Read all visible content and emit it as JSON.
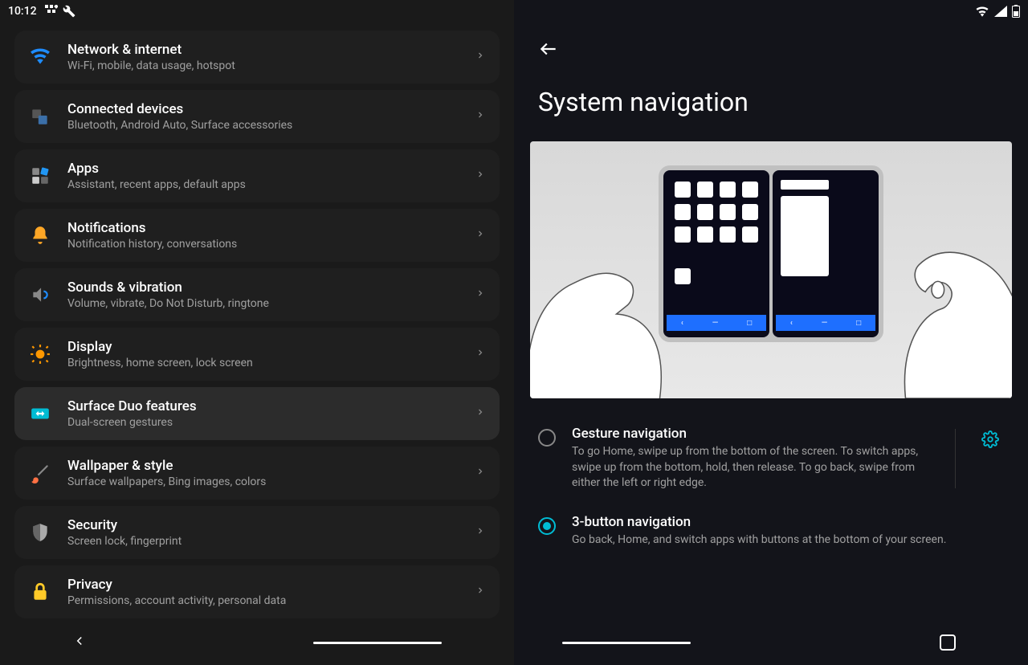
{
  "status": {
    "time": "10:12"
  },
  "settings": [
    {
      "title": "Network & internet",
      "sub": "Wi-Fi, mobile, data usage, hotspot",
      "icon": "wifi",
      "color": "#1e8cff"
    },
    {
      "title": "Connected devices",
      "sub": "Bluetooth, Android Auto, Surface accessories",
      "icon": "devices",
      "color": "#3b6fa8"
    },
    {
      "title": "Apps",
      "sub": "Assistant, recent apps, default apps",
      "icon": "apps",
      "color": "#5a5a5a"
    },
    {
      "title": "Notifications",
      "sub": "Notification history, conversations",
      "icon": "bell",
      "color": "#ffa726"
    },
    {
      "title": "Sounds & vibration",
      "sub": "Volume, vibrate, Do Not Disturb, ringtone",
      "icon": "sound",
      "color": "#1e8cff"
    },
    {
      "title": "Display",
      "sub": "Brightness, home screen, lock screen",
      "icon": "sun",
      "color": "#ff9800"
    },
    {
      "title": "Surface Duo features",
      "sub": "Dual-screen gestures",
      "icon": "duo",
      "color": "#00bcd4",
      "selected": true
    },
    {
      "title": "Wallpaper & style",
      "sub": "Surface wallpapers, Bing images, colors",
      "icon": "brush",
      "color": "#ff7043"
    },
    {
      "title": "Security",
      "sub": "Screen lock, fingerprint",
      "icon": "shield",
      "color": "#888"
    },
    {
      "title": "Privacy",
      "sub": "Permissions, account activity, personal data",
      "icon": "lock",
      "color": "#ffca28"
    }
  ],
  "detail": {
    "title": "System navigation",
    "options": [
      {
        "title": "Gesture navigation",
        "desc": "To go Home, swipe up from the bottom of the screen. To switch apps, swipe up from the bottom, hold, then release. To go back, swipe from either the left or right edge.",
        "selected": false,
        "has_settings": true
      },
      {
        "title": "3-button navigation",
        "desc": "Go back, Home, and switch apps with buttons at the bottom of your screen.",
        "selected": true,
        "has_settings": false
      }
    ]
  }
}
